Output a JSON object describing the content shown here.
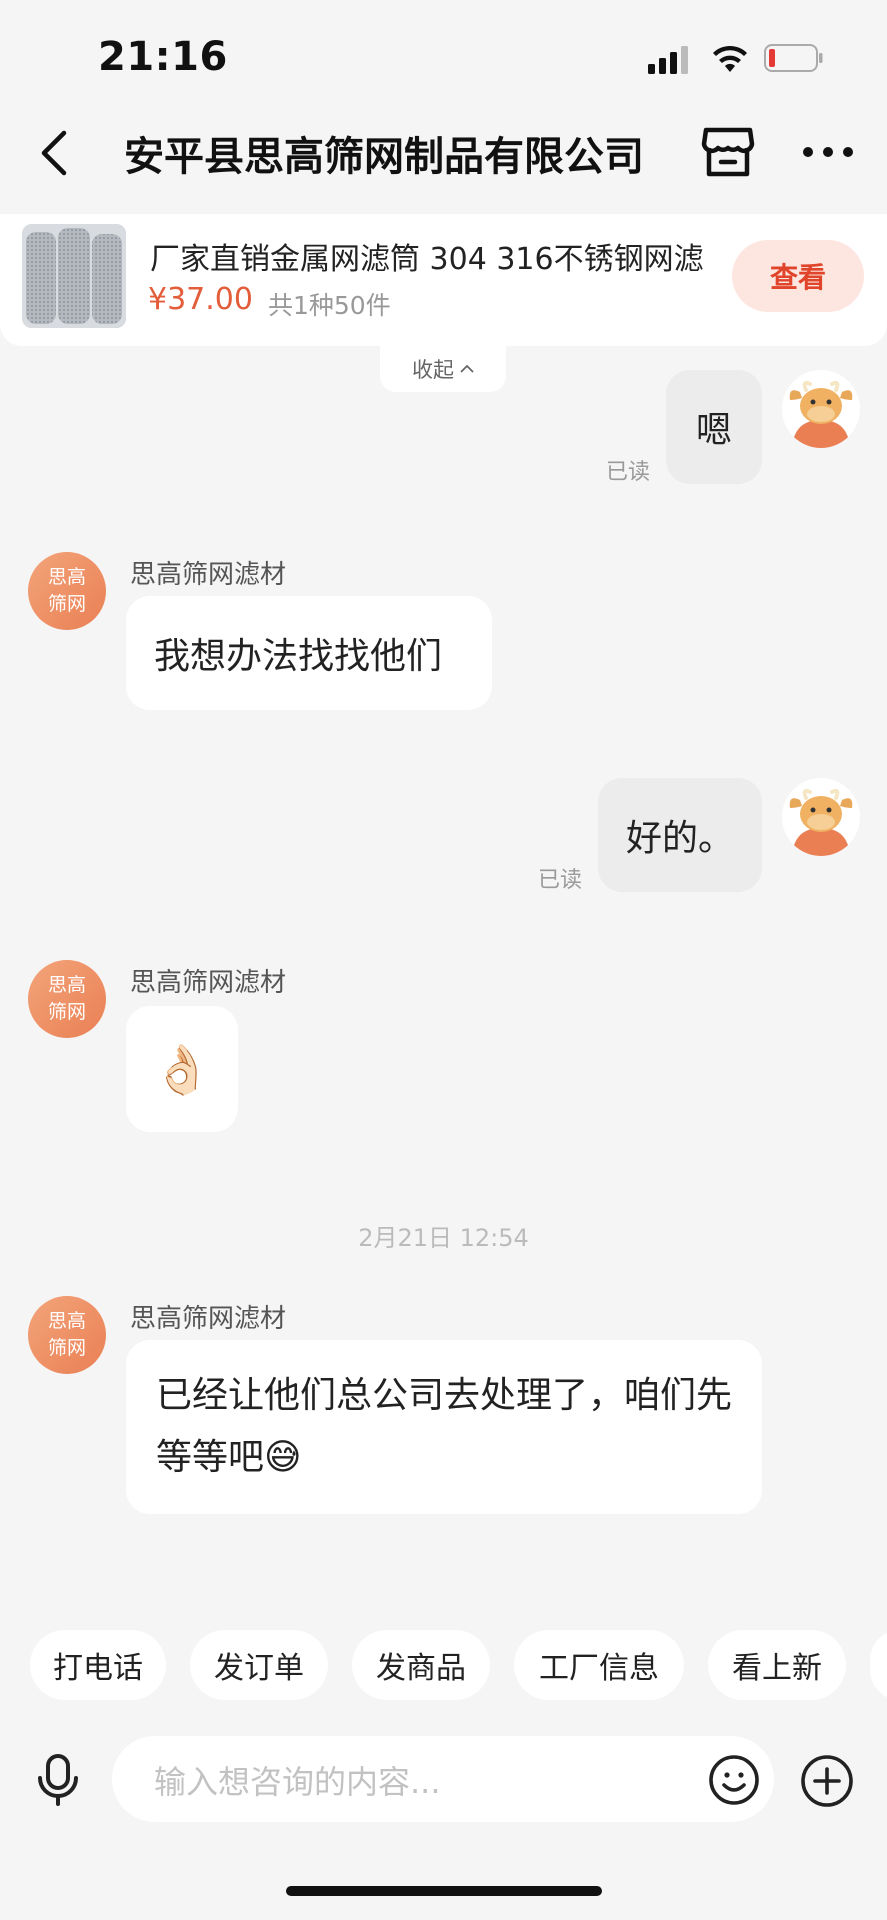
{
  "status_bar": {
    "time": "21:16"
  },
  "nav": {
    "title": "安平县思高筛网制品有限公司",
    "back_icon": "chevron-left-icon",
    "store_icon": "store-icon",
    "more_icon": "more-dots-icon"
  },
  "product": {
    "title": "厂家直销金属网滤筒 304 316不锈钢网滤",
    "price": "¥37.00",
    "quantity": "共1种50件",
    "view_label": "查看",
    "collapse_label": "收起"
  },
  "shop": {
    "name": "思高筛网滤材",
    "avatar_line1": "思高",
    "avatar_line2": "筛网"
  },
  "messages": [
    {
      "from": "me",
      "text": "嗯",
      "status": "已读"
    },
    {
      "from": "shop",
      "text": "我想办法找找他们"
    },
    {
      "from": "me",
      "text": "好的。",
      "status": "已读"
    },
    {
      "from": "shop",
      "emoji": "👌🏻"
    },
    {
      "from": "shop",
      "text": "已经让他们总公司去处理了，咱们先等等吧😅"
    }
  ],
  "time_divider": "2月21日 12:54",
  "quick_actions": [
    "打电话",
    "发订单",
    "发商品",
    "工厂信息",
    "看上新"
  ],
  "input": {
    "placeholder": "输入想咨询的内容..."
  },
  "colors": {
    "accent": "#e35d3a",
    "view_button_bg": "#fde6df",
    "my_bubble": "#ececec",
    "shop_avatar": "#ea7f54"
  }
}
